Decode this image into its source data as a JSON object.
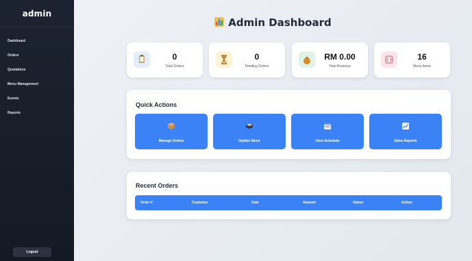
{
  "sidebar": {
    "brand": "admin",
    "items": [
      {
        "label": "Dashboard"
      },
      {
        "label": "Orders"
      },
      {
        "label": "Quotations"
      },
      {
        "label": "Menu Management"
      },
      {
        "label": "Events"
      },
      {
        "label": "Reports"
      }
    ],
    "logout_label": "Logout"
  },
  "header": {
    "title": "Admin Dashboard",
    "icon": "bar-chart-icon"
  },
  "stats": [
    {
      "value": "0",
      "label": "Total Orders",
      "icon": "clipboard-icon",
      "icon_bg": "#e3eefc"
    },
    {
      "value": "0",
      "label": "Pending Orders",
      "icon": "hourglass-icon",
      "icon_bg": "#fdf3d3"
    },
    {
      "value": "RM 0.00",
      "label": "Total Revenue",
      "icon": "money-bag-icon",
      "icon_bg": "#dff4e6"
    },
    {
      "value": "16",
      "label": "Menu Items",
      "icon": "fork-knife-icon",
      "icon_bg": "#fde4ea"
    }
  ],
  "quick_actions": {
    "title": "Quick Actions",
    "buttons": [
      {
        "label": "Manage Orders",
        "icon": "package-icon"
      },
      {
        "label": "Update Menu",
        "icon": "book-icon"
      },
      {
        "label": "View Schedule",
        "icon": "calendar-icon"
      },
      {
        "label": "Sales Reports",
        "icon": "trend-chart-icon"
      }
    ]
  },
  "recent_orders": {
    "title": "Recent Orders",
    "columns": [
      "Order #",
      "Customer",
      "Date",
      "Amount",
      "Status",
      "Action"
    ]
  },
  "colors": {
    "accent": "#3b82f6",
    "sidebar": "#1a202b"
  }
}
